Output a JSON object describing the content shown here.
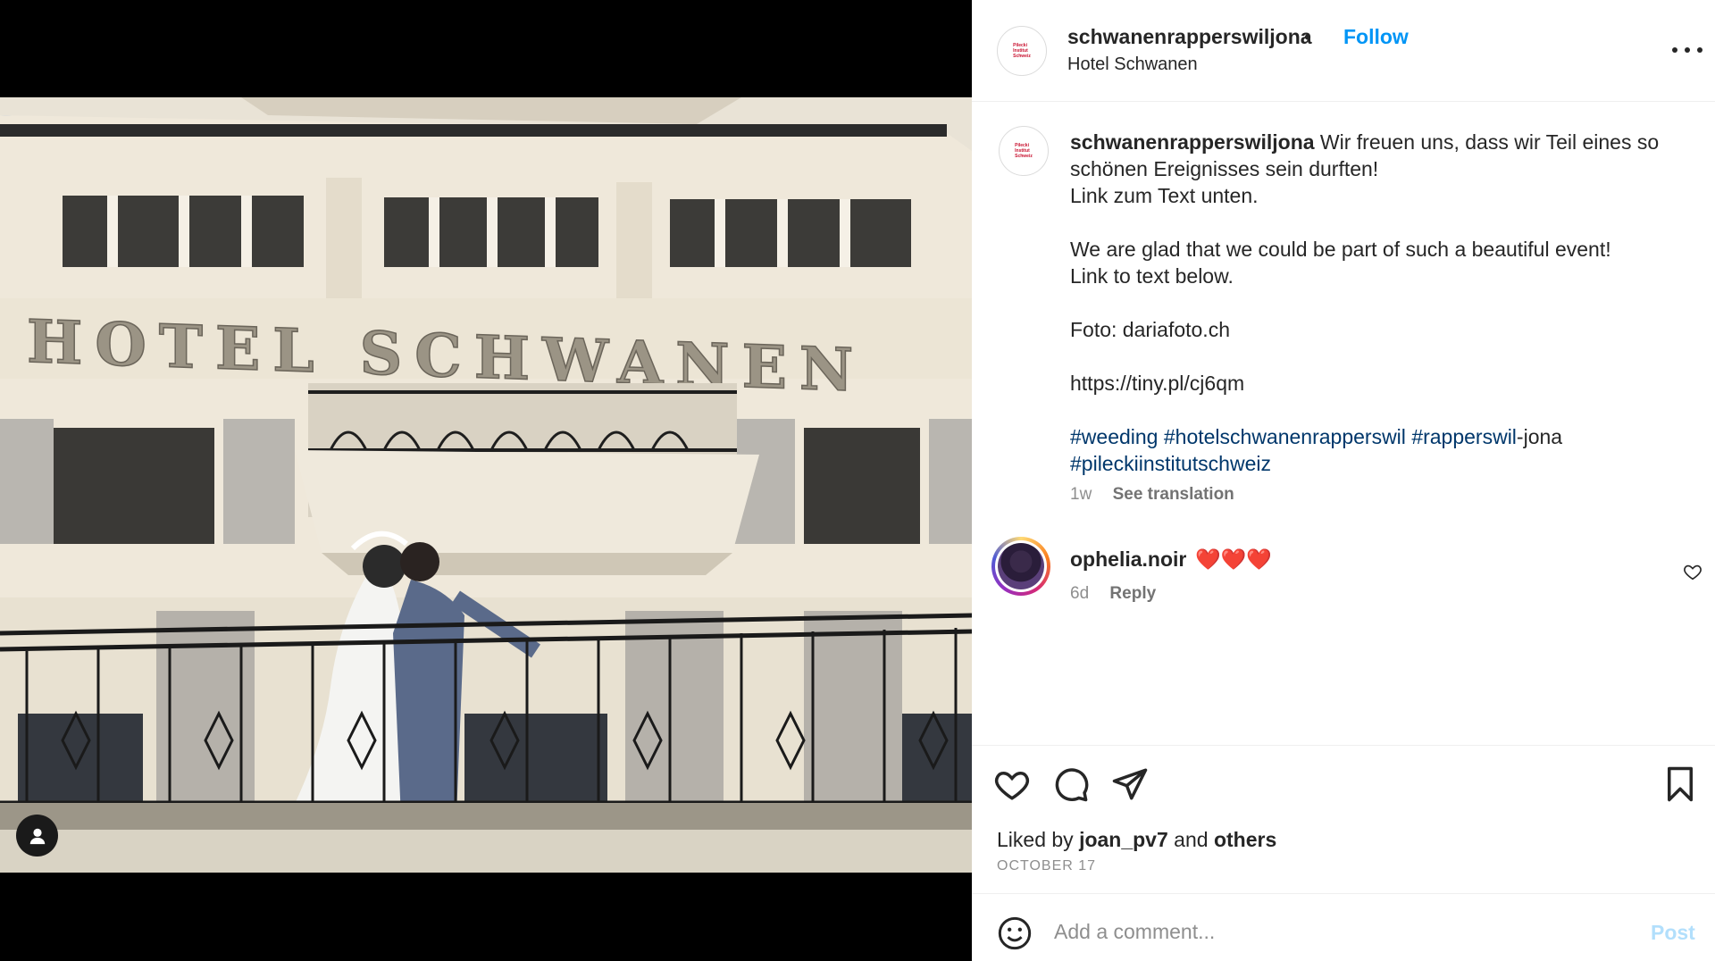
{
  "post": {
    "username": "schwanenrapperswiljona",
    "separator": "•",
    "follow_label": "Follow",
    "location": "Hotel Schwanen",
    "avatar_logo_text": "Pilecki\nInstitut\nSchweiz",
    "photo_sign_text": "HOTEL SCHWANEN",
    "caption": {
      "username": "schwanenrapperswiljona",
      "line1": "Wir freuen uns, dass wir Teil eines so schönen Ereignisses sein durften!",
      "line2": "Link zum Text unten.",
      "line3": "We are glad that we could be part of such a beautiful event!",
      "line4": "Link to text below.",
      "line5": "Foto: dariafoto.ch",
      "line6": "https://tiny.pl/cj6qm",
      "hashtag1": "#weeding",
      "hashtag2": "#hotelschwanenrapperswil",
      "hashtag3": "#rapperswil",
      "hashtag3_suffix": "-jona",
      "hashtag4": "#pileckiinstitutschweiz"
    },
    "caption_meta": {
      "age": "1w",
      "see_translation": "See translation"
    },
    "comment": {
      "username": "ophelia.noir",
      "text": "❤️❤️❤️",
      "age": "6d",
      "reply_label": "Reply"
    },
    "likes": {
      "prefix": "Liked by",
      "user": "joan_pv7",
      "and": "and",
      "others": "others"
    },
    "date": "OCTOBER 17",
    "comment_box": {
      "placeholder": "Add a comment...",
      "post_label": "Post"
    },
    "icons": {
      "like": "heart-icon",
      "comment": "comment-icon",
      "share": "paper-plane-icon",
      "save": "bookmark-icon",
      "more": "more-icon",
      "emoji": "emoji-icon",
      "tags": "user-tag-icon"
    },
    "colors": {
      "follow": "#0095f6",
      "hashtag": "#00376b",
      "muted": "#8e8e8e",
      "post_disabled": "#b2dffc"
    }
  }
}
